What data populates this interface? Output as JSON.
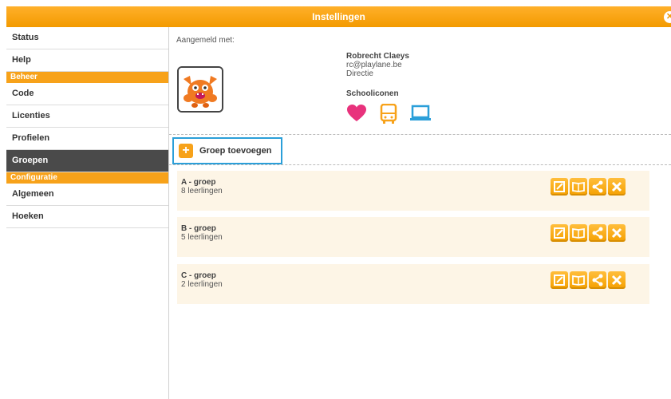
{
  "window": {
    "title": "Instellingen"
  },
  "sidebar": {
    "items": [
      {
        "label": "Status"
      },
      {
        "label": "Help"
      },
      {
        "section": "Beheer"
      },
      {
        "label": "Code"
      },
      {
        "label": "Licenties"
      },
      {
        "label": "Profielen"
      },
      {
        "label": "Groepen",
        "active": true
      },
      {
        "section": "Configuratie"
      },
      {
        "label": "Algemeen"
      },
      {
        "label": "Hoeken"
      }
    ]
  },
  "account": {
    "logged_in_label": "Aangemeld met:",
    "name": "Robrecht Claeys",
    "email": "rc@playlane.be",
    "role": "Directie",
    "school_icons_title": "Schooliconen",
    "school_icons": [
      "heart-icon",
      "bus-icon",
      "laptop-icon"
    ]
  },
  "add_group": {
    "label": "Groep toevoegen"
  },
  "groups": [
    {
      "name": "A - groep",
      "count": "8 leerlingen"
    },
    {
      "name": "B - groep",
      "count": "5 leerlingen"
    },
    {
      "name": "C - groep",
      "count": "2 leerlingen"
    }
  ],
  "colors": {
    "accent": "#f7a21a",
    "active_nav": "#4a4a4a",
    "highlight_border": "#2b9fd9",
    "group_row_bg": "#fdf5e6",
    "heart": "#e8327c",
    "bus": "#f7a21a",
    "laptop": "#2b9fd9"
  }
}
